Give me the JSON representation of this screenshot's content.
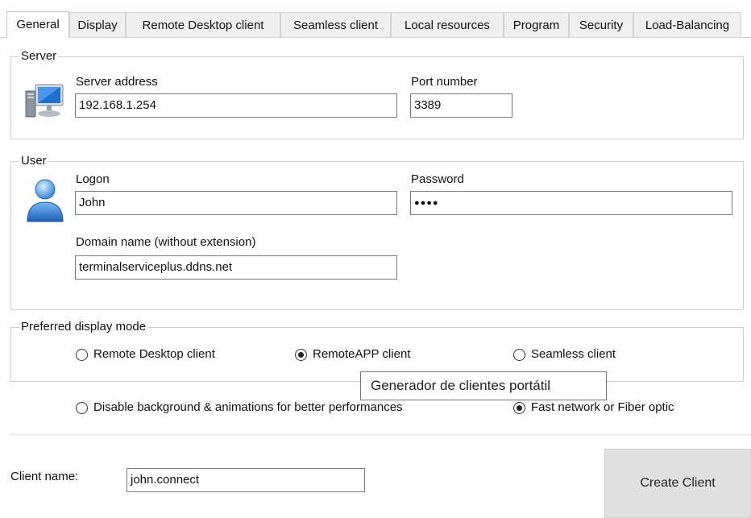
{
  "tabs": [
    {
      "label": "General"
    },
    {
      "label": "Display"
    },
    {
      "label": "Remote Desktop client"
    },
    {
      "label": "Seamless client"
    },
    {
      "label": "Local resources"
    },
    {
      "label": "Program"
    },
    {
      "label": "Security"
    },
    {
      "label": "Load-Balancing"
    }
  ],
  "active_tab": "General",
  "server": {
    "title": "Server",
    "icon": "computer-monitor-icon",
    "address_label": "Server address",
    "address_value": "192.168.1.254",
    "port_label": "Port number",
    "port_value": "3389"
  },
  "user": {
    "title": "User",
    "icon": "user-avatar-icon",
    "logon_label": "Logon",
    "logon_value": "John",
    "password_label": "Password",
    "password_value": "●●●●",
    "domain_label": "Domain name (without extension)",
    "domain_value": "terminalserviceplus.ddns.net"
  },
  "display_mode": {
    "title": "Preferred display mode",
    "options": [
      {
        "label": "Remote Desktop client",
        "selected": false
      },
      {
        "label": "RemoteAPP client",
        "selected": true
      },
      {
        "label": "Seamless client",
        "selected": false
      }
    ]
  },
  "performance": {
    "options": [
      {
        "label": "Disable background & animations for better performances",
        "selected": false
      },
      {
        "label": "Fast network or Fiber optic",
        "selected": true
      }
    ]
  },
  "tooltip": "Generador de clientes portátil",
  "client_name": {
    "label": "Client name:",
    "value": "john.connect"
  },
  "create_button": "Create Client"
}
